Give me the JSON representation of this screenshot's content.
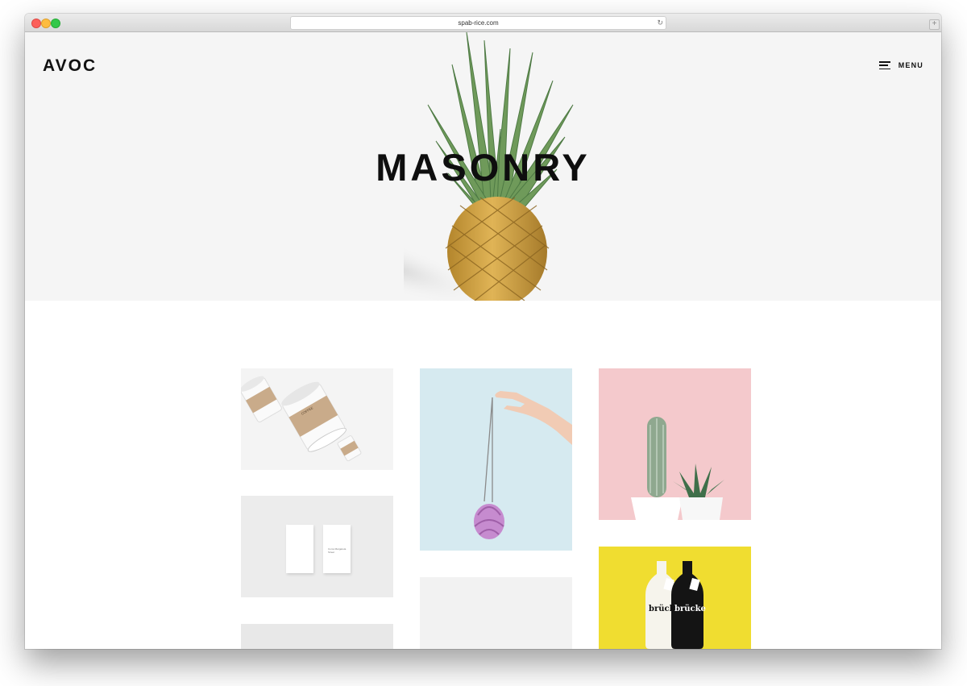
{
  "browser": {
    "url": "spab-rice.com"
  },
  "header": {
    "logo": "AVOC",
    "menu_label": "MENU"
  },
  "hero": {
    "title": "MASONRY"
  },
  "portfolio": {
    "items": [
      {
        "name": "coffee-cups-tile",
        "label": "COFFEE"
      },
      {
        "name": "business-cards-tile",
        "label": "Coms Margareta Street"
      },
      {
        "name": "artichoke-necklace-tile",
        "label": ""
      },
      {
        "name": "cactus-pots-tile",
        "label": ""
      },
      {
        "name": "brucke-bottles-tile",
        "label": "brücke"
      }
    ]
  },
  "colors": {
    "hero_bg": "#f5f5f5",
    "blue_tile": "#d6eaf0",
    "pink_tile": "#f4c9cc",
    "yellow_tile": "#f0dd30"
  }
}
